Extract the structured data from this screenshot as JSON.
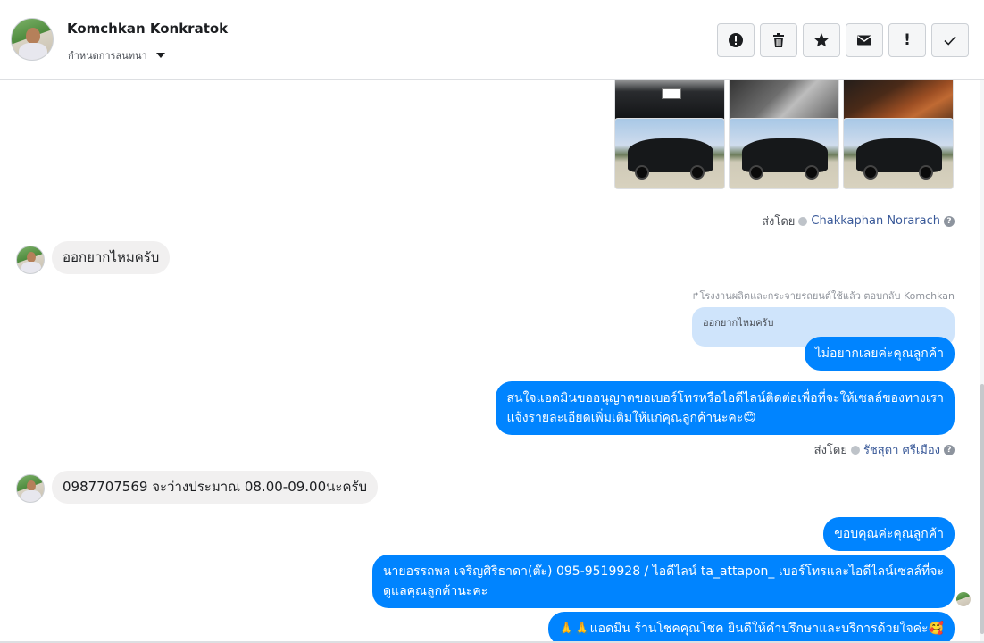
{
  "header": {
    "name": "Komchkan Konkratok",
    "assign_label": "กำหนดการสนทนา",
    "toolbar": [
      {
        "name": "report-button",
        "icon": "alert-circle-icon"
      },
      {
        "name": "delete-button",
        "icon": "trash-icon"
      },
      {
        "name": "star-button",
        "icon": "star-icon"
      },
      {
        "name": "unread-button",
        "icon": "envelope-icon"
      },
      {
        "name": "important-button",
        "icon": "exclamation-icon",
        "glyph": "!"
      },
      {
        "name": "done-button",
        "icon": "check-icon"
      }
    ]
  },
  "conversation": {
    "photo_block": {
      "sent_by_label": "ส่งโดย",
      "sender": "Chakkaphan Norarach"
    },
    "messages": [
      {
        "direction": "in",
        "text": "ออกยากไหมครับ"
      },
      {
        "direction": "out",
        "reply_label": "↱โรงงานผลิตและกระจายรถยนต์ใช้แล้ว ตอบกลับ Komchkan",
        "quoted": "ออกยากไหมครับ",
        "text": "ไม่อยากเลยค่ะคุณลูกค้า"
      },
      {
        "direction": "out",
        "lines": [
          "สนใจแอดมินขออนุญาตขอเบอร์โทรหรือไอดีไลน์ติดต่อเพื่อที่จะให้เซลล์ของทางเรา",
          "แจ้งรายละเอียดเพิ่มเติมให้แก่คุณลูกค้านะคะ😊"
        ],
        "sent_by_label": "ส่งโดย",
        "sender": "รัชสุดา ศรีเมือง"
      },
      {
        "direction": "in",
        "text": "0987707569  จะว่างประมาณ  08.00-09.00นะครับ"
      },
      {
        "direction": "out",
        "text": "ขอบคุณค่ะคุณลูกค้า"
      },
      {
        "direction": "out",
        "lines": [
          "นายอรรถพล เจริญศิริธาดา(ต๊ะ)      095-9519928 / ไอดีไลน์ ta_attapon_  เบอร์โทรและไอดีไลน์เซลล์ที่จะ",
          "ดูแลคุณลูกค้านะคะ"
        ]
      },
      {
        "direction": "out",
        "text": "🙏🙏แอดมิน ร้านโชคคุณโชค ยินดีให้คำปรึกษาและบริการด้วยใจค่ะ🥰"
      }
    ]
  },
  "colors": {
    "outgoing_bubble": "#0084ff",
    "incoming_bubble": "#f1f0f0",
    "quoted_bubble": "#cfe4fb",
    "link": "#385898"
  }
}
